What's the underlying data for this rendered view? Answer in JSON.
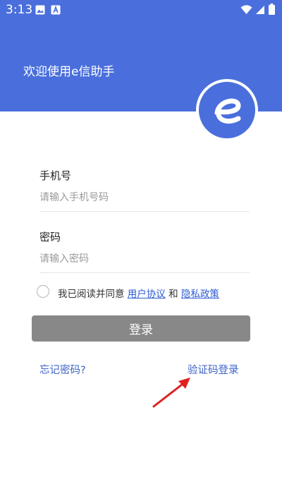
{
  "status_bar": {
    "time": "3:13",
    "left_icons": [
      "image-icon",
      "letter-a-icon"
    ],
    "right_icons": [
      "wifi-icon",
      "cellular-icon",
      "battery-icon"
    ]
  },
  "header": {
    "welcome_text": "欢迎使用e信助手",
    "background_color": "#4a6fdc",
    "logo": "e-logo-icon"
  },
  "form": {
    "phone": {
      "label": "手机号",
      "placeholder": "请输入手机号码",
      "value": ""
    },
    "password": {
      "label": "密码",
      "placeholder": "请输入密码",
      "value": ""
    }
  },
  "agreement": {
    "checked": false,
    "prefix": "我已阅读并同意",
    "user_agreement": "用户协议",
    "conjunction": "和",
    "privacy_policy": "隐私政策"
  },
  "login_button": {
    "label": "登录",
    "color": "#888888"
  },
  "links": {
    "forgot_password": "忘记密码?",
    "sms_login": "验证码登录",
    "color": "#3f63c9"
  },
  "annotation": {
    "arrow_color": "#e02020",
    "points_to": "sms_login"
  }
}
